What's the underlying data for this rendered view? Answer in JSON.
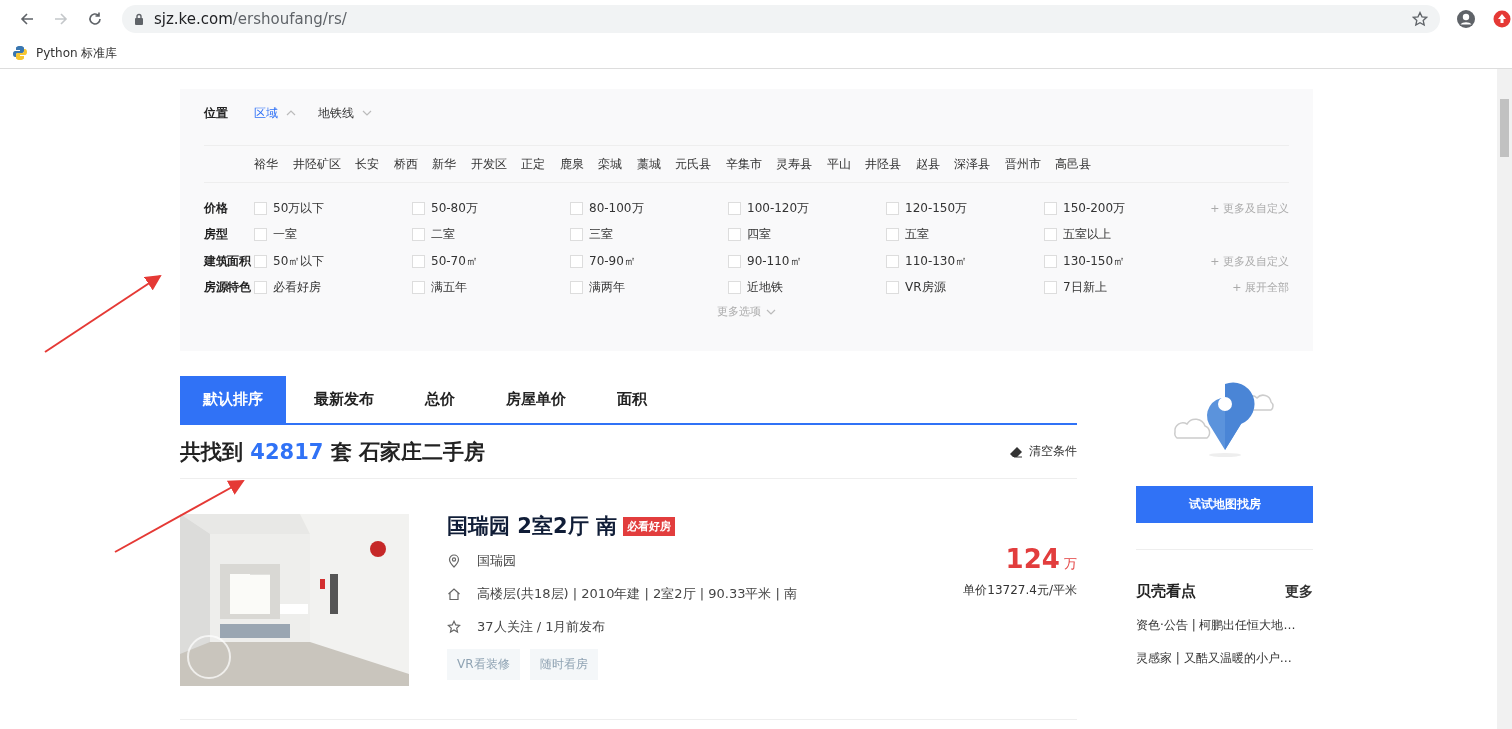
{
  "browser": {
    "url_host": "sjz.ke.com",
    "url_path": "/ershoufang/rs/",
    "bookmarks": [
      {
        "label": "Python 标准库"
      }
    ]
  },
  "location": {
    "label": "位置",
    "tabs": [
      {
        "label": "区域",
        "selected": true
      },
      {
        "label": "地铁线",
        "selected": false
      }
    ],
    "districts": [
      "裕华",
      "井陉矿区",
      "长安",
      "桥西",
      "新华",
      "开发区",
      "正定",
      "鹿泉",
      "栾城",
      "藁城",
      "元氏县",
      "辛集市",
      "灵寿县",
      "平山",
      "井陉县",
      "赵县",
      "深泽县",
      "晋州市",
      "高邑县"
    ]
  },
  "filters": [
    {
      "label": "价格",
      "options": [
        {
          "label": "50万以下",
          "checked": false
        },
        {
          "label": "50-80万",
          "checked": false
        },
        {
          "label": "80-100万",
          "checked": false
        },
        {
          "label": "100-120万",
          "checked": false
        },
        {
          "label": "120-150万",
          "checked": false
        },
        {
          "label": "150-200万",
          "checked": false
        }
      ],
      "extra": "+ 更多及自定义"
    },
    {
      "label": "房型",
      "options": [
        {
          "label": "一室",
          "checked": false
        },
        {
          "label": "二室",
          "checked": false
        },
        {
          "label": "三室",
          "checked": false
        },
        {
          "label": "四室",
          "checked": false
        },
        {
          "label": "五室",
          "checked": false
        },
        {
          "label": "五室以上",
          "checked": false
        }
      ]
    },
    {
      "label": "建筑面积",
      "options": [
        {
          "label": "50㎡以下",
          "checked": false
        },
        {
          "label": "50-70㎡",
          "checked": false
        },
        {
          "label": "70-90㎡",
          "checked": false
        },
        {
          "label": "90-110㎡",
          "checked": false
        },
        {
          "label": "110-130㎡",
          "checked": false
        },
        {
          "label": "130-150㎡",
          "checked": false
        }
      ],
      "extra": "+ 更多及自定义"
    },
    {
      "label": "房源特色",
      "options": [
        {
          "label": "必看好房",
          "checked": false
        },
        {
          "label": "满五年",
          "checked": false
        },
        {
          "label": "满两年",
          "checked": false
        },
        {
          "label": "近地铁",
          "checked": false
        },
        {
          "label": "VR房源",
          "checked": false
        },
        {
          "label": "7日新上",
          "checked": false
        }
      ],
      "extra": "+ 展开全部"
    }
  ],
  "more_options": "更多选项",
  "sort_tabs": [
    {
      "label": "默认排序",
      "selected": true
    },
    {
      "label": "最新发布",
      "selected": false
    },
    {
      "label": "总价",
      "selected": false
    },
    {
      "label": "房屋单价",
      "selected": false
    },
    {
      "label": "面积",
      "selected": false
    }
  ],
  "result": {
    "prefix": "共找到",
    "count": "42817",
    "suffix": "套 石家庄二手房",
    "clear": "清空条件"
  },
  "listings": [
    {
      "title": "国瑞园 2室2厅 南",
      "badge": "必看好房",
      "community": "国瑞园",
      "info": "高楼层(共18层) | 2010年建 | 2室2厅 | 90.33平米 | 南",
      "follow": "37人关注 / 1月前发布",
      "price": "124",
      "price_unit": "万",
      "unit_price": "单价13727.4元/平米",
      "tags": [
        "VR看装修",
        "随时看房"
      ]
    }
  ],
  "sidebar": {
    "map_button": "试试地图找房",
    "news_title": "贝壳看点",
    "news_more": "更多",
    "news": [
      "资色·公告 | 柯鹏出任恒大地…",
      "灵感家 | 又酷又温暖的小户…"
    ]
  }
}
